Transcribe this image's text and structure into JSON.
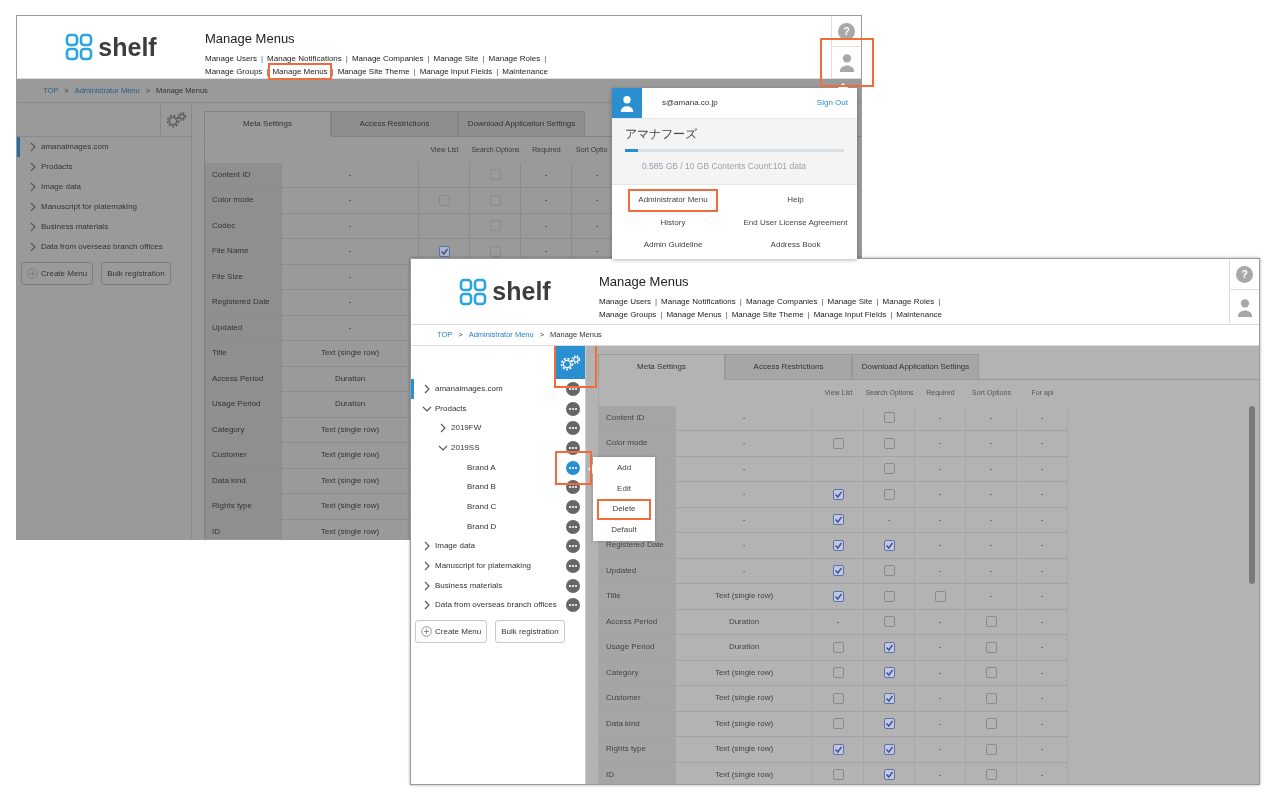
{
  "back_window": {
    "logo": "shelf",
    "title": "Manage Menus",
    "nav": {
      "separator": "|",
      "lines": [
        [
          {
            "label": "Manage Users",
            "highlighted": false
          },
          {
            "label": "Manage Notifications",
            "highlighted": false
          },
          {
            "label": "Manage Companies",
            "highlighted": false
          },
          {
            "label": "Manage Site",
            "highlighted": false
          },
          {
            "label": "Manage Roles",
            "highlighted": false
          }
        ],
        [
          {
            "label": "Manage Groups",
            "highlighted": false
          },
          {
            "label": "Manage Menus",
            "highlighted": true
          },
          {
            "label": "Manage Site Theme",
            "highlighted": false
          },
          {
            "label": "Manage Input Fields",
            "highlighted": false
          },
          {
            "label": "Maintenance",
            "highlighted": false
          }
        ]
      ]
    },
    "help_glyph": "?",
    "user_button": {
      "highlighted": true
    },
    "breadcrumb": {
      "separator": ">",
      "items": [
        {
          "label": "TOP",
          "kind": "link"
        },
        {
          "label": "Administrator Menu",
          "kind": "link"
        },
        {
          "label": "Manage Menus",
          "kind": "current"
        }
      ]
    },
    "body_dimmed": true,
    "settings_button": {
      "active": false,
      "highlighted": false
    },
    "tree": [
      {
        "label": "amanaimages.com",
        "kind": "group",
        "expanded": false,
        "selected": true
      },
      {
        "label": "Prodacts",
        "kind": "group",
        "expanded": false,
        "selected": false
      },
      {
        "label": "Image data",
        "kind": "group",
        "expanded": false,
        "selected": false
      },
      {
        "label": "Manuscript for platemaking",
        "kind": "group",
        "expanded": false,
        "selected": false
      },
      {
        "label": "Business materials",
        "kind": "group",
        "expanded": false,
        "selected": false
      },
      {
        "label": "Data from overseas branch offices",
        "kind": "group",
        "expanded": false,
        "selected": false
      }
    ],
    "buttons": [
      {
        "label": "Create Menu",
        "kind": "add"
      },
      {
        "label": "Bulk registration",
        "kind": "plain"
      }
    ],
    "tabs": [
      {
        "label": "Meta Settings",
        "selected": true
      },
      {
        "label": "Access Restrictions",
        "selected": false
      },
      {
        "label": "Download Application Settings",
        "selected": false
      }
    ],
    "table": {
      "columns": [
        "View List",
        "Search Options",
        "Required",
        "Sort Optio"
      ],
      "rows": [
        {
          "name": "Content ID",
          "type": "-",
          "cells": [
            {
              "kind": "empty"
            },
            {
              "kind": "check",
              "checked": false
            },
            {
              "kind": "text",
              "text": "-"
            },
            {
              "kind": "text",
              "text": "-"
            }
          ]
        },
        {
          "name": "Color mode",
          "type": "-",
          "cells": [
            {
              "kind": "check",
              "checked": false
            },
            {
              "kind": "check",
              "checked": false
            },
            {
              "kind": "text",
              "text": "-"
            },
            {
              "kind": "text",
              "text": "-"
            }
          ]
        },
        {
          "name": "Codec",
          "type": "-",
          "cells": [
            {
              "kind": "empty"
            },
            {
              "kind": "check",
              "checked": false
            },
            {
              "kind": "text",
              "text": "-"
            },
            {
              "kind": "text",
              "text": "-"
            }
          ]
        },
        {
          "name": "File Name",
          "type": "-",
          "cells": [
            {
              "kind": "check",
              "checked": true
            },
            {
              "kind": "check",
              "checked": false
            },
            {
              "kind": "text",
              "text": "-"
            },
            {
              "kind": "text",
              "text": "-"
            }
          ]
        },
        {
          "name": "File Size",
          "type": "-"
        },
        {
          "name": "Registered Date",
          "type": "-"
        },
        {
          "name": "Updated",
          "type": "-"
        },
        {
          "name": "Title",
          "type": "Text (single row)"
        },
        {
          "name": "Access Period",
          "type": "Duration"
        },
        {
          "name": "Usage Period",
          "type": "Duration"
        },
        {
          "name": "Category",
          "type": "Text (single row)"
        },
        {
          "name": "Customer",
          "type": "Text (single row)"
        },
        {
          "name": "Data kind",
          "type": "Text (single row)"
        },
        {
          "name": "Rights type",
          "type": "Text (single row)"
        },
        {
          "name": "ID",
          "type": "Text (single row)"
        }
      ]
    },
    "user_panel": {
      "email": "s@amana.co.jp",
      "sign_out": "Sign Out",
      "company": "アマナフーズ",
      "level": 0.06,
      "usage": "0.585 GB / 10 GB  Contents Count:101  data",
      "links": [
        {
          "label": "Administrator Menu",
          "highlighted": true
        },
        {
          "label": "Help",
          "highlighted": false
        },
        {
          "label": "History",
          "highlighted": false
        },
        {
          "label": "End User License Agreement",
          "highlighted": false
        },
        {
          "label": "Admin Guideline",
          "highlighted": false
        },
        {
          "label": "Address Book",
          "highlighted": false
        }
      ]
    }
  },
  "front_window": {
    "logo": "shelf",
    "title": "Manage Menus",
    "nav": {
      "separator": "|",
      "lines": [
        [
          {
            "label": "Manage Users",
            "highlighted": false
          },
          {
            "label": "Manage Notifications",
            "highlighted": false
          },
          {
            "label": "Manage Companies",
            "highlighted": false
          },
          {
            "label": "Manage Site",
            "highlighted": false
          },
          {
            "label": "Manage Roles",
            "highlighted": false
          }
        ],
        [
          {
            "label": "Manage Groups",
            "highlighted": false
          },
          {
            "label": "Manage Menus",
            "highlighted": false
          },
          {
            "label": "Manage Site Theme",
            "highlighted": false
          },
          {
            "label": "Manage Input Fields",
            "highlighted": false
          },
          {
            "label": "Maintenance",
            "highlighted": false
          }
        ]
      ]
    },
    "help_glyph": "?",
    "user_button": {
      "highlighted": false
    },
    "breadcrumb": {
      "separator": ">",
      "items": [
        {
          "label": "TOP",
          "kind": "link"
        },
        {
          "label": "Administrator Menu",
          "kind": "link"
        },
        {
          "label": "Manage Menus",
          "kind": "current"
        }
      ]
    },
    "body_dimmed": false,
    "settings_button": {
      "active": true,
      "highlighted": true
    },
    "tree": [
      {
        "label": "amanaimages.com",
        "kind": "group",
        "expanded": false,
        "selected": true,
        "menu_open": false,
        "highlighted": false
      },
      {
        "label": "Prodacts",
        "kind": "group",
        "expanded": true,
        "selected": false,
        "menu_open": false,
        "highlighted": false,
        "children": [
          {
            "label": "2019FW",
            "kind": "group",
            "expanded": false,
            "selected": false,
            "menu_open": false,
            "highlighted": false
          },
          {
            "label": "2019SS",
            "kind": "group",
            "expanded": true,
            "selected": false,
            "menu_open": false,
            "highlighted": false,
            "children": [
              {
                "label": "Brand A",
                "kind": "leaf",
                "selected": false,
                "menu_open": true,
                "highlighted": true
              },
              {
                "label": "Brand B",
                "kind": "leaf",
                "selected": false,
                "menu_open": false,
                "highlighted": false
              },
              {
                "label": "Brand C",
                "kind": "leaf",
                "selected": false,
                "menu_open": false,
                "highlighted": false
              },
              {
                "label": "Brand D",
                "kind": "leaf",
                "selected": false,
                "menu_open": false,
                "highlighted": false
              }
            ]
          }
        ]
      },
      {
        "label": "Image data",
        "kind": "group",
        "expanded": false,
        "selected": false,
        "menu_open": false,
        "highlighted": false
      },
      {
        "label": "Manuscript for platemaking",
        "kind": "group",
        "expanded": false,
        "selected": false,
        "menu_open": false,
        "highlighted": false
      },
      {
        "label": "Business materials",
        "kind": "group",
        "expanded": false,
        "selected": false,
        "menu_open": false,
        "highlighted": false
      },
      {
        "label": "Data from overseas branch offices",
        "kind": "group",
        "expanded": false,
        "selected": false,
        "menu_open": false,
        "highlighted": false
      }
    ],
    "buttons": [
      {
        "label": "Create Menu",
        "kind": "add"
      },
      {
        "label": "Bulk registration",
        "kind": "plain"
      }
    ],
    "tabs": [
      {
        "label": "Meta Settings",
        "selected": true
      },
      {
        "label": "Access Restrictions",
        "selected": false
      },
      {
        "label": "Download Application Settings",
        "selected": false
      }
    ],
    "table": {
      "columns": [
        "View List",
        "Search Options",
        "Required",
        "Sort Options",
        "For api"
      ],
      "rows": [
        {
          "name": "Content ID",
          "type": "-",
          "cells": [
            {
              "kind": "empty"
            },
            {
              "kind": "check",
              "checked": false
            },
            {
              "kind": "text",
              "text": "-"
            },
            {
              "kind": "text",
              "text": "-"
            },
            {
              "kind": "text",
              "text": "-"
            }
          ]
        },
        {
          "name": "Color mode",
          "type": "-",
          "cells": [
            {
              "kind": "check",
              "checked": false
            },
            {
              "kind": "check",
              "checked": false
            },
            {
              "kind": "text",
              "text": "-"
            },
            {
              "kind": "text",
              "text": "-"
            },
            {
              "kind": "text",
              "text": "-"
            }
          ]
        },
        {
          "type": "-",
          "cells": [
            {
              "kind": "empty"
            },
            {
              "kind": "check",
              "checked": false
            },
            {
              "kind": "text",
              "text": "-"
            },
            {
              "kind": "text",
              "text": "-"
            },
            {
              "kind": "text",
              "text": "-"
            }
          ]
        },
        {
          "type": "-",
          "cells": [
            {
              "kind": "check",
              "checked": true
            },
            {
              "kind": "check",
              "checked": false
            },
            {
              "kind": "text",
              "text": "-"
            },
            {
              "kind": "text",
              "text": "-"
            },
            {
              "kind": "text",
              "text": "-"
            }
          ]
        },
        {
          "type": "-",
          "cells": [
            {
              "kind": "check",
              "checked": true
            },
            {
              "kind": "text",
              "text": "-"
            },
            {
              "kind": "text",
              "text": "-"
            },
            {
              "kind": "text",
              "text": "-"
            },
            {
              "kind": "text",
              "text": "-"
            }
          ]
        },
        {
          "name": "Registered Date",
          "type": "-",
          "cells": [
            {
              "kind": "check",
              "checked": true
            },
            {
              "kind": "check",
              "checked": true
            },
            {
              "kind": "text",
              "text": "-"
            },
            {
              "kind": "text",
              "text": "-"
            },
            {
              "kind": "text",
              "text": "-"
            }
          ]
        },
        {
          "name": "Updated",
          "type": "-",
          "cells": [
            {
              "kind": "check",
              "checked": true
            },
            {
              "kind": "check",
              "checked": false
            },
            {
              "kind": "text",
              "text": "-"
            },
            {
              "kind": "text",
              "text": "-"
            },
            {
              "kind": "text",
              "text": "-"
            }
          ]
        },
        {
          "name": "Title",
          "type": "Text (single row)",
          "cells": [
            {
              "kind": "check",
              "checked": true
            },
            {
              "kind": "check",
              "checked": false
            },
            {
              "kind": "check",
              "checked": false
            },
            {
              "kind": "text",
              "text": "-"
            },
            {
              "kind": "text",
              "text": "-"
            }
          ]
        },
        {
          "name": "Access Period",
          "type": "Duration",
          "cells": [
            {
              "kind": "text",
              "text": "-"
            },
            {
              "kind": "check",
              "checked": false
            },
            {
              "kind": "text",
              "text": "-"
            },
            {
              "kind": "check",
              "checked": false
            },
            {
              "kind": "text",
              "text": "-"
            }
          ]
        },
        {
          "name": "Usage Period",
          "type": "Duration",
          "cells": [
            {
              "kind": "check",
              "checked": false
            },
            {
              "kind": "check",
              "checked": true
            },
            {
              "kind": "text",
              "text": "-"
            },
            {
              "kind": "check",
              "checked": false
            },
            {
              "kind": "text",
              "text": "-"
            }
          ]
        },
        {
          "name": "Category",
          "type": "Text (single row)",
          "cells": [
            {
              "kind": "check",
              "checked": false
            },
            {
              "kind": "check",
              "checked": true
            },
            {
              "kind": "text",
              "text": "-"
            },
            {
              "kind": "check",
              "checked": false
            },
            {
              "kind": "text",
              "text": "-"
            }
          ]
        },
        {
          "name": "Customer",
          "type": "Text (single row)",
          "cells": [
            {
              "kind": "check",
              "checked": false
            },
            {
              "kind": "check",
              "checked": true
            },
            {
              "kind": "text",
              "text": "-"
            },
            {
              "kind": "check",
              "checked": false
            },
            {
              "kind": "text",
              "text": "-"
            }
          ]
        },
        {
          "name": "Data kind",
          "type": "Text (single row)",
          "cells": [
            {
              "kind": "check",
              "checked": false
            },
            {
              "kind": "check",
              "checked": true
            },
            {
              "kind": "text",
              "text": "-"
            },
            {
              "kind": "check",
              "checked": false
            },
            {
              "kind": "text",
              "text": "-"
            }
          ]
        },
        {
          "name": "Rights type",
          "type": "Text (single row)",
          "cells": [
            {
              "kind": "check",
              "checked": true
            },
            {
              "kind": "check",
              "checked": true
            },
            {
              "kind": "text",
              "text": "-"
            },
            {
              "kind": "check",
              "checked": false
            },
            {
              "kind": "text",
              "text": "-"
            }
          ]
        },
        {
          "name": "ID",
          "type": "Text (single row)",
          "cells": [
            {
              "kind": "check",
              "checked": false
            },
            {
              "kind": "check",
              "checked": true
            },
            {
              "kind": "text",
              "text": "-"
            },
            {
              "kind": "check",
              "checked": false
            },
            {
              "kind": "text",
              "text": "-"
            }
          ]
        }
      ]
    },
    "context_menu": {
      "items": [
        {
          "label": "Add",
          "highlighted": false
        },
        {
          "label": "Edit",
          "highlighted": false
        },
        {
          "label": "Delete",
          "highlighted": true
        },
        {
          "label": "Default",
          "highlighted": false
        }
      ]
    }
  }
}
